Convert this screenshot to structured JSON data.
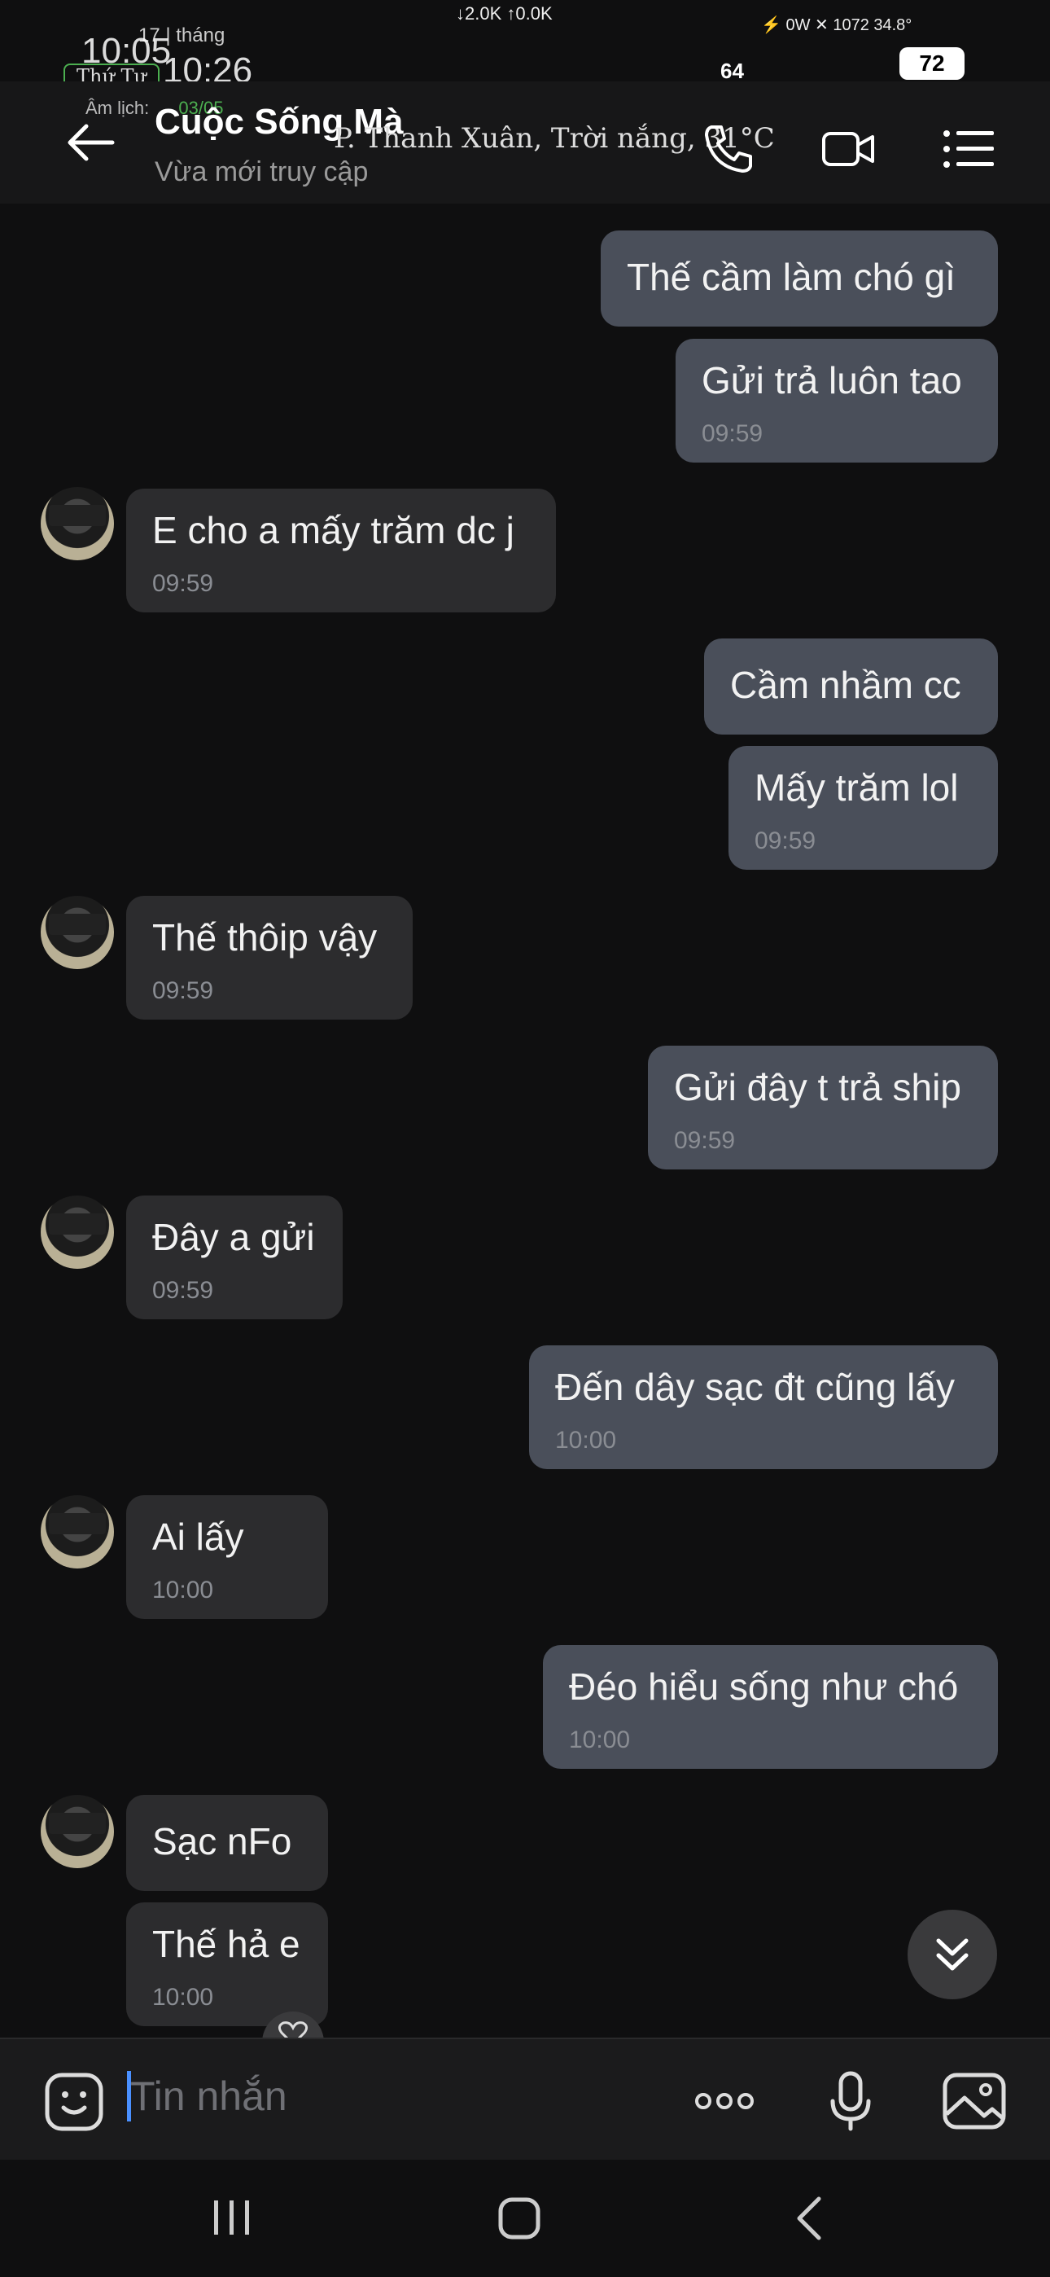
{
  "status_bar": {
    "time": "10:05",
    "overlay_time": "10:26",
    "day_label": "Thứ Tư",
    "lunar_label": "Âm lịch:",
    "lunar_date": "03/05",
    "date_fragment": "17 | tháng",
    "net_speed": "↓2.0K ↑0.0K",
    "right_info": "⚡ 0W   ✕ 1072   34.8°",
    "badge_64": "64",
    "battery": "72",
    "weather": "P. Thanh Xuân, Trời nắng, 31°C"
  },
  "header": {
    "back_icon": "arrow-left-icon",
    "contact_name": "Cuộc Sống Mà",
    "contact_status": "Vừa mới truy cập",
    "call_icon": "phone-icon",
    "video_icon": "video-camera-icon",
    "menu_icon": "list-menu-icon"
  },
  "messages": [
    {
      "dir": "out",
      "text": "Thế cầm làm chó gì",
      "time": ""
    },
    {
      "dir": "out",
      "text": "Gửi trả luôn tao",
      "time": "09:59"
    },
    {
      "dir": "in",
      "text": "E cho a mấy trăm dc j",
      "time": "09:59"
    },
    {
      "dir": "out",
      "text": "Cầm nhầm cc",
      "time": ""
    },
    {
      "dir": "out",
      "text": "Mấy trăm lol",
      "time": "09:59"
    },
    {
      "dir": "in",
      "text": "Thế thôip vậy",
      "time": "09:59"
    },
    {
      "dir": "out",
      "text": "Gửi đây t trả ship",
      "time": "09:59"
    },
    {
      "dir": "in",
      "text": "Đây a gửi",
      "time": "09:59"
    },
    {
      "dir": "out",
      "text": "Đến dây sạc đt cũng lấy",
      "time": "10:00"
    },
    {
      "dir": "in",
      "text": "Ai lấy",
      "time": "10:00"
    },
    {
      "dir": "out",
      "text": "Đéo hiểu sống như chó",
      "time": "10:00"
    },
    {
      "dir": "in",
      "text": "Sạc nFo",
      "time": ""
    },
    {
      "dir": "in",
      "text": "Thế hả e",
      "time": "10:00"
    }
  ],
  "input_bar": {
    "placeholder": "Tin nhắn",
    "sticker_icon": "smiley-sticker-icon",
    "more_icon": "more-dots-icon",
    "mic_icon": "microphone-icon",
    "image_icon": "image-gallery-icon"
  },
  "nav_bar": {
    "recents_icon": "recents-icon",
    "home_icon": "home-icon",
    "back_icon": "back-chevron-icon"
  },
  "colors": {
    "background": "#0f0f10",
    "bubble_out": "#4a4f5a",
    "bubble_in": "#2c2c2e",
    "caret": "#4a90ff"
  }
}
